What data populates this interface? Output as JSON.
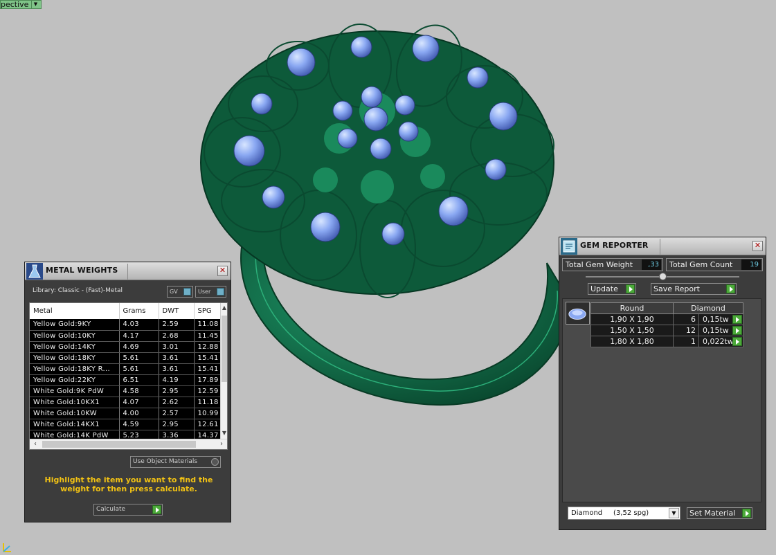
{
  "viewport": {
    "label": "pective"
  },
  "metal_weights": {
    "title": "METAL WEIGHTS",
    "library": "Library: Classic - (Fast)-Metal",
    "toggles": {
      "gv": "GV",
      "user": "User"
    },
    "columns": [
      "Metal",
      "Grams",
      "DWT",
      "SPG"
    ],
    "rows": [
      [
        "Yellow Gold:9KY",
        "4.03",
        "2.59",
        "11.08"
      ],
      [
        "Yellow Gold:10KY",
        "4.17",
        "2.68",
        "11.45"
      ],
      [
        "Yellow Gold:14KY",
        "4.69",
        "3.01",
        "12.88"
      ],
      [
        "Yellow Gold:18KY",
        "5.61",
        "3.61",
        "15.41"
      ],
      [
        "Yellow Gold:18KY R...",
        "5.61",
        "3.61",
        "15.41"
      ],
      [
        "Yellow Gold:22KY",
        "6.51",
        "4.19",
        "17.89"
      ],
      [
        "White Gold:9K PdW",
        "4.58",
        "2.95",
        "12.59"
      ],
      [
        "White Gold:10KX1",
        "4.07",
        "2.62",
        "11.18"
      ],
      [
        "White Gold:10KW",
        "4.00",
        "2.57",
        "10.99"
      ],
      [
        "White Gold:14KX1",
        "4.59",
        "2.95",
        "12.61"
      ],
      [
        "White Gold:14K PdW",
        "5.23",
        "3.36",
        "14.37"
      ]
    ],
    "use_object_materials": "Use Object Materials",
    "hint": "Highlight the item you want to find the weight for then press calculate.",
    "calculate": "Calculate",
    "accent": "#f2c214"
  },
  "gem_reporter": {
    "title": "GEM REPORTER",
    "total_weight_label": "Total Gem Weight",
    "total_weight_value": ",33",
    "total_count_label": "Total Gem Count",
    "total_count_value": "19",
    "update": "Update",
    "save_report": "Save Report",
    "columns": [
      "Round",
      "Diamond"
    ],
    "rows": [
      {
        "size": "1,90 X 1,90",
        "count": "6",
        "weight": "0,15tw"
      },
      {
        "size": "1,50 X 1,50",
        "count": "12",
        "weight": "0,15tw"
      },
      {
        "size": "1,80 X 1,80",
        "count": "1",
        "weight": "0,022tw"
      }
    ],
    "material": "Diamond     (3,52 spg)",
    "set_material": "Set Material"
  }
}
